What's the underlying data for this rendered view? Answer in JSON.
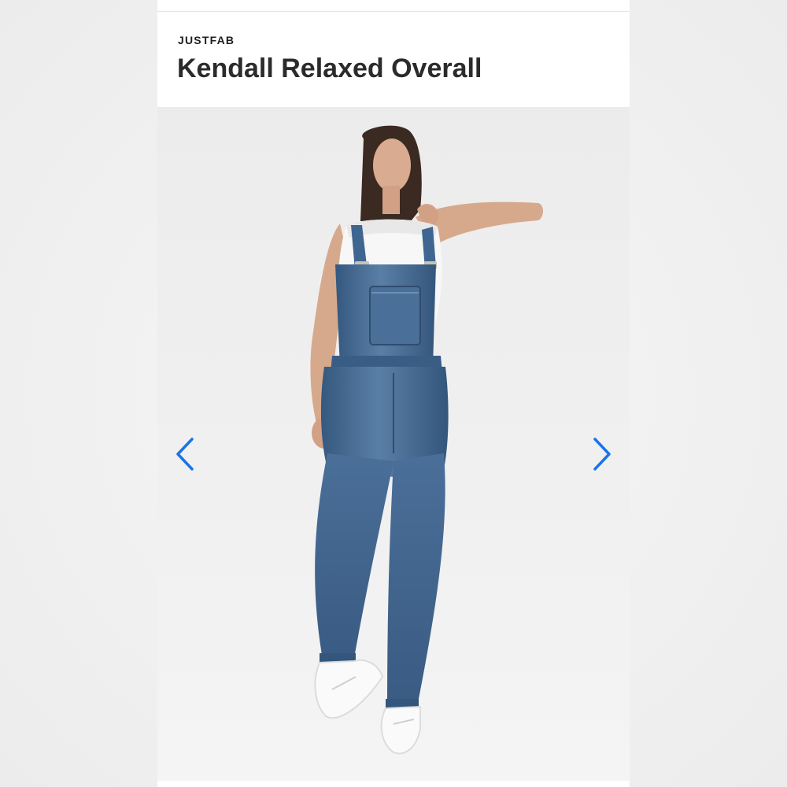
{
  "product": {
    "brand": "JUSTFAB",
    "title": "Kendall Relaxed Overall"
  },
  "gallery": {
    "image_alt": "Kendall Relaxed Overall",
    "prev_icon": "chevron-left-icon",
    "next_icon": "chevron-right-icon"
  },
  "colors": {
    "accent": "#1a73e8",
    "denim": "#3f6591",
    "text": "#2b2b2b"
  }
}
